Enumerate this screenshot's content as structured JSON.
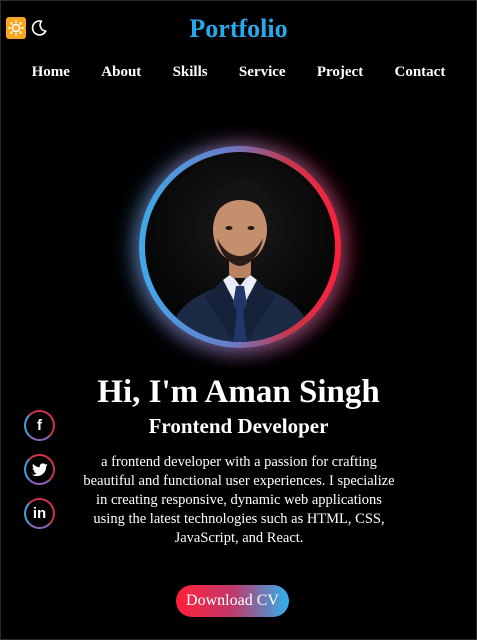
{
  "header": {
    "title": "Portfolio",
    "theme_icons": [
      "sun-icon",
      "moon-icon"
    ]
  },
  "nav": {
    "items": [
      "Home",
      "About",
      "Skills",
      "Service",
      "Project",
      "Contact"
    ]
  },
  "hero": {
    "name": "Hi, I'm Aman Singh",
    "role": "Frontend Developer",
    "description": "a frontend developer with a passion for crafting beautiful and functional user experiences. I specialize in creating responsive, dynamic web applications using the latest technologies such as HTML, CSS, JavaScript, and React.",
    "cta_label": "Download CV"
  },
  "socials": {
    "facebook_glyph": "f",
    "linkedin_glyph": "in"
  },
  "colors": {
    "background": "#000000",
    "title": "#29a9ec",
    "ring_left": "#3fa9e8",
    "ring_right": "#ff1f3a"
  }
}
